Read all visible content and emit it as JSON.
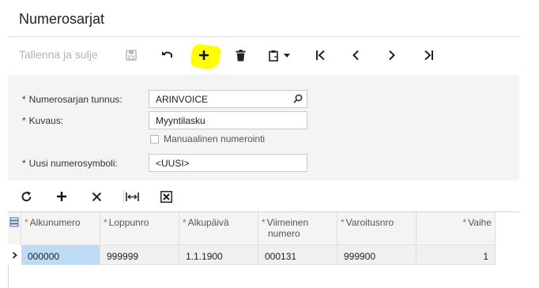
{
  "page": {
    "title": "Numerosarjat"
  },
  "toolbar": {
    "save_close_label": "Tallenna ja sulje",
    "icons": [
      "save-icon",
      "undo-icon",
      "add-icon",
      "delete-icon",
      "clipboard-icon",
      "chevron-down-icon",
      "first-icon",
      "previous-icon",
      "next-icon",
      "last-icon"
    ],
    "highlight_color": "#ffff00"
  },
  "form": {
    "series_id": {
      "label": "Numerosarjan tunnus:",
      "value": "ARINVOICE"
    },
    "description": {
      "label": "Kuvaus:",
      "value": "Myyntilasku"
    },
    "manual_numbering": {
      "label": "Manuaalinen numerointi",
      "checked": false
    },
    "new_symbol": {
      "label": "Uusi numerosymboli:",
      "value": "<UUSI>"
    },
    "required_marker": "*"
  },
  "grid_toolbar": {
    "icons": [
      "refresh-icon",
      "add-row-icon",
      "delete-row-icon",
      "fit-columns-icon",
      "export-excel-icon"
    ]
  },
  "grid": {
    "required_marker": "*",
    "columns": [
      {
        "label": "Alkunumero",
        "label2": ""
      },
      {
        "label": "Loppunro",
        "label2": ""
      },
      {
        "label": "Alkupäivä",
        "label2": ""
      },
      {
        "label": "Viimeinen",
        "label2": "numero"
      },
      {
        "label": "Varoitusnro",
        "label2": ""
      },
      {
        "label": "Vaihe",
        "label2": ""
      }
    ],
    "rows": [
      {
        "cells": [
          "000000",
          "999999",
          "1.1.1900",
          "000131",
          "999900",
          "1"
        ]
      }
    ],
    "selected_color": "#bcdcf5"
  }
}
